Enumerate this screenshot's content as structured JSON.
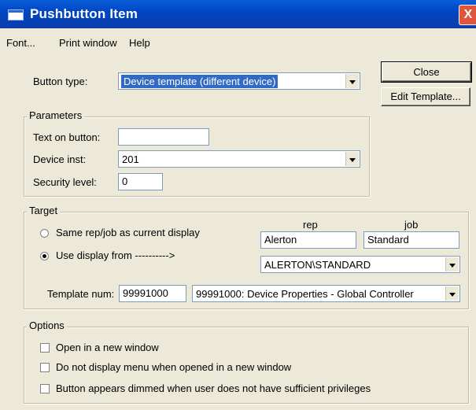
{
  "window": {
    "title": "Pushbutton Item",
    "close_glyph": "X"
  },
  "menu": [
    "Font...",
    "Print window",
    "Help"
  ],
  "button_type": {
    "label": "Button type:",
    "value": "Device template (different device)"
  },
  "buttons": {
    "close": "Close",
    "edit_template": "Edit Template..."
  },
  "parameters": {
    "title": "Parameters",
    "text_on_button": {
      "label": "Text on button:",
      "value": ""
    },
    "device_inst": {
      "label": "Device inst:",
      "value": "201"
    },
    "security_level": {
      "label": "Security level:",
      "value": "0"
    }
  },
  "target": {
    "title": "Target",
    "radio_same": {
      "label": "Same rep/job as current display",
      "checked": false
    },
    "radio_use": {
      "label": "Use display from ---------->",
      "checked": true
    },
    "rep": {
      "header": "rep",
      "value": "Alerton"
    },
    "job": {
      "header": "job",
      "value": "Standard"
    },
    "path": {
      "value": "ALERTON\\STANDARD"
    },
    "template_num": {
      "label": "Template num:",
      "value": "99991000"
    },
    "template_select": {
      "value": "99991000: Device Properties - Global Controller"
    }
  },
  "options": {
    "title": "Options",
    "items": [
      {
        "label": "Open in a new window",
        "checked": false
      },
      {
        "label": "Do not display menu when opened in a new window",
        "checked": false
      },
      {
        "label": "Button appears dimmed when user does not have sufficient privileges",
        "checked": false
      }
    ]
  },
  "colors": {
    "titlebar": "#0046c4",
    "selection": "#316ac5",
    "close_button": "#e0553b"
  }
}
